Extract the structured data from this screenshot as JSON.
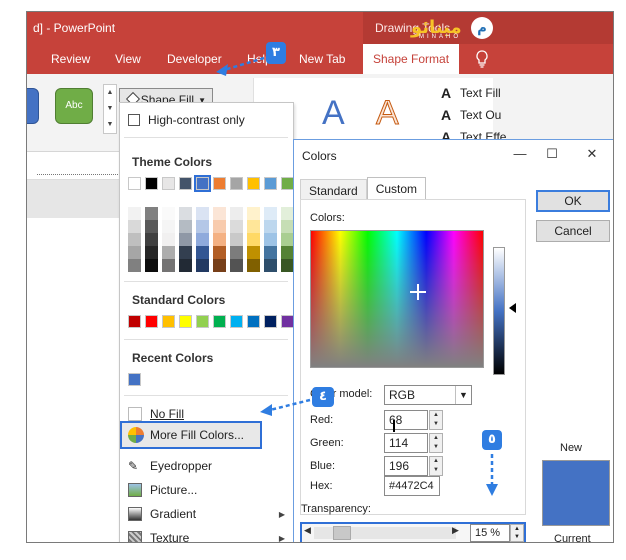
{
  "window": {
    "title": "d] - PowerPoint",
    "context_tab_group": "Drawing Tools"
  },
  "logo": {
    "text": "مینائو",
    "sub": "MINAHO",
    "badge": "م"
  },
  "tabs": [
    {
      "label": "Review"
    },
    {
      "label": "View"
    },
    {
      "label": "Developer"
    },
    {
      "label": "Help"
    },
    {
      "label": "New Tab"
    },
    {
      "label": "Shape Format"
    }
  ],
  "ribbon": {
    "style_preview_label": "Abc",
    "shape_fill_label": "Shape Fill",
    "wordart_letter": "A",
    "text_fill": "Text Fill",
    "text_outline": "Text Ou",
    "text_effects": "Text Effe"
  },
  "menu": {
    "high_contrast": "High-contrast only",
    "theme_colors_title": "Theme Colors",
    "theme_colors": [
      "#FFFFFF",
      "#000000",
      "#E7E6E6",
      "#44546A",
      "#4472C4",
      "#ED7D31",
      "#A5A5A5",
      "#FFC000",
      "#5B9BD5",
      "#70AD47"
    ],
    "standard_colors_title": "Standard Colors",
    "standard_colors": [
      "#C00000",
      "#FF0000",
      "#FFC000",
      "#FFFF00",
      "#92D050",
      "#00B050",
      "#00B0F0",
      "#0070C0",
      "#002060",
      "#7030A0"
    ],
    "recent_colors_title": "Recent Colors",
    "recent_colors": [
      "#4472C4"
    ],
    "no_fill": "No Fill",
    "more_fill_colors": "More Fill Colors...",
    "eyedropper": "Eyedropper",
    "picture": "Picture...",
    "gradient": "Gradient",
    "texture": "Texture"
  },
  "dialog": {
    "title": "Colors",
    "tabs": [
      "Standard",
      "Custom"
    ],
    "active_tab": "Custom",
    "colors_label": "Colors:",
    "color_model_label": "Color model:",
    "color_model_value": "RGB",
    "red_label": "Red:",
    "red_value": "68",
    "green_label": "Green:",
    "green_value": "114",
    "blue_label": "Blue:",
    "blue_value": "196",
    "hex_label": "Hex:",
    "hex_value": "#4472C4",
    "transparency_label": "Transparency:",
    "transparency_value": "15 %",
    "transparency_fraction": 0.15,
    "ok": "OK",
    "cancel": "Cancel",
    "new_label": "New",
    "current_label": "Current",
    "current_color": "#4472C4"
  },
  "annotations": {
    "step3": "٣",
    "step4": "٤",
    "step5": "٥"
  },
  "colors": {
    "title_red": "#C6423A",
    "accent_blue": "#2F7DE1"
  }
}
